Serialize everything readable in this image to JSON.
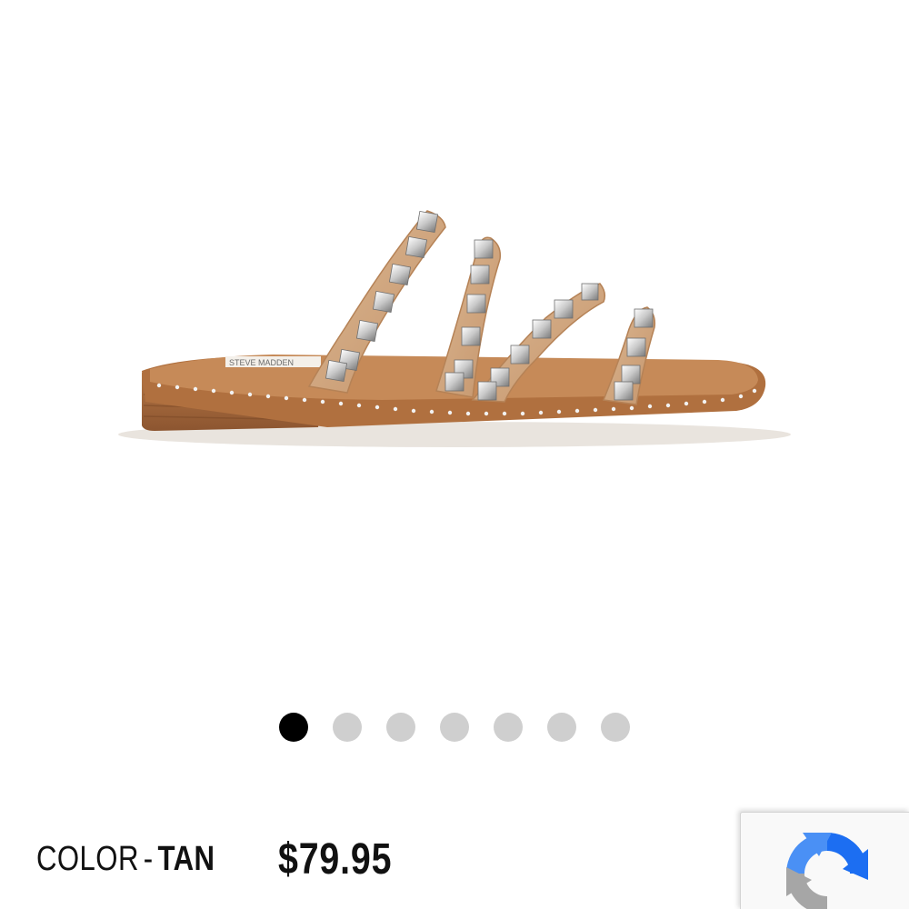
{
  "product": {
    "image_alt": "Tan studded strappy slide sandal",
    "brand_label": "STEVE MADDEN",
    "color_prefix": "COLOR",
    "color_separator": "-",
    "color_value": "TAN",
    "price": "$79.95"
  },
  "carousel": {
    "total": 7,
    "active_index": 0
  },
  "colors": {
    "accent": "#000000",
    "dot_inactive": "#cfcfcf",
    "sandal_tan": "#c99a72",
    "sole_brown": "#a8683a",
    "recaptcha_blue": "#1c6ef2",
    "recaptcha_gray": "#a6a6a6"
  },
  "icons": {
    "recaptcha": "recaptcha-icon"
  }
}
